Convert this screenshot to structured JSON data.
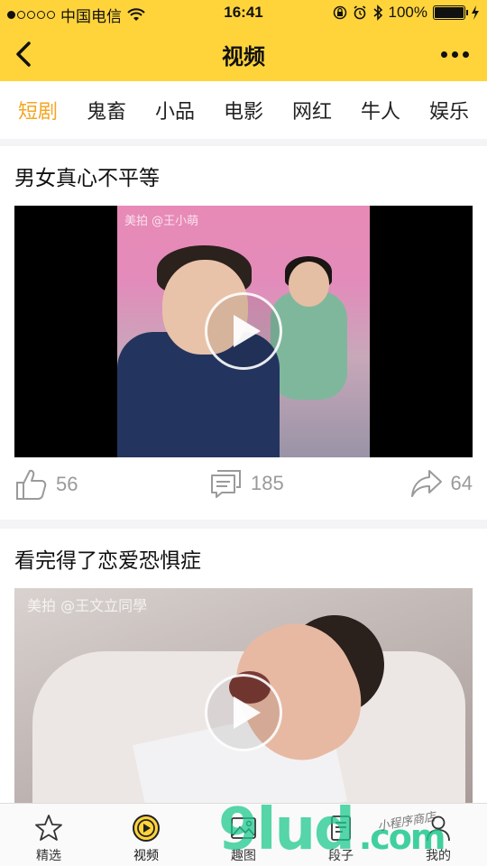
{
  "status_bar": {
    "carrier": "中国电信",
    "time": "16:41",
    "battery": "100%"
  },
  "nav": {
    "title": "视频"
  },
  "tabs": [
    {
      "label": "短剧",
      "active": true
    },
    {
      "label": "鬼畜"
    },
    {
      "label": "小品"
    },
    {
      "label": "电影"
    },
    {
      "label": "网红"
    },
    {
      "label": "牛人"
    },
    {
      "label": "娱乐"
    }
  ],
  "videos": [
    {
      "title": "男女真心不平等",
      "watermark": "美拍 @王小萌",
      "likes": "56",
      "comments": "185",
      "shares": "64"
    },
    {
      "title": "看完得了恋爱恐惧症",
      "watermark": "美拍 @王文立同學"
    }
  ],
  "tab_bar": [
    {
      "label": "精选",
      "icon": "star-icon"
    },
    {
      "label": "视频",
      "icon": "play-circle-icon",
      "active": true
    },
    {
      "label": "趣图",
      "icon": "image-icon"
    },
    {
      "label": "段子",
      "icon": "document-icon"
    },
    {
      "label": "我的",
      "icon": "user-icon"
    }
  ],
  "overlay": {
    "logo_text": "9lud",
    "logo_domain": ".com",
    "handwriting": "小程序商店"
  },
  "colors": {
    "accent": "#ffd43b",
    "active_tab": "#f5a623"
  }
}
